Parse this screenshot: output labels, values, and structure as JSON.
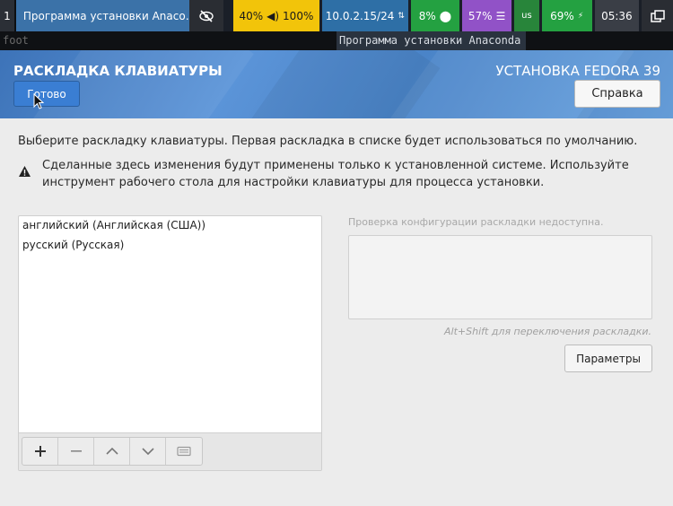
{
  "status_bar": {
    "workspace": "1",
    "window_title": "Программа установки Anaco…",
    "volume": "40%",
    "brightness": "100%",
    "network": "10.0.2.15/24",
    "cpu": "8%",
    "memory": "57%",
    "keyboard_layout": "us",
    "battery": "69%",
    "clock": "05:36"
  },
  "app_bar": {
    "terminal": "foot",
    "title": "Программа установки Anaconda"
  },
  "header": {
    "title": "РАСКЛАДКА КЛАВИАТУРЫ",
    "product": "УСТАНОВКА FEDORA 39",
    "done_label": "Готово",
    "help_label": "Справка"
  },
  "content": {
    "instruction": "Выберите раскладку клавиатуры. Первая раскладка в списке будет использоваться по умолчанию.",
    "warning": "Сделанные здесь изменения будут применены только к установленной системе. Используйте инструмент рабочего стола для настройки клавиатуры для процесса установки.",
    "layouts": [
      "английский (Английская (США))",
      "русский (Русская)"
    ],
    "preview_unavailable": "Проверка конфигурации раскладки недоступна.",
    "switch_hint": "Alt+Shift для переключения раскладки.",
    "options_label": "Параметры"
  },
  "colors": {
    "header_blue": "#4a84c8",
    "yellow_segment": "#f2c40a",
    "green_segment": "#24a141",
    "purple_segment": "#9152c7"
  }
}
